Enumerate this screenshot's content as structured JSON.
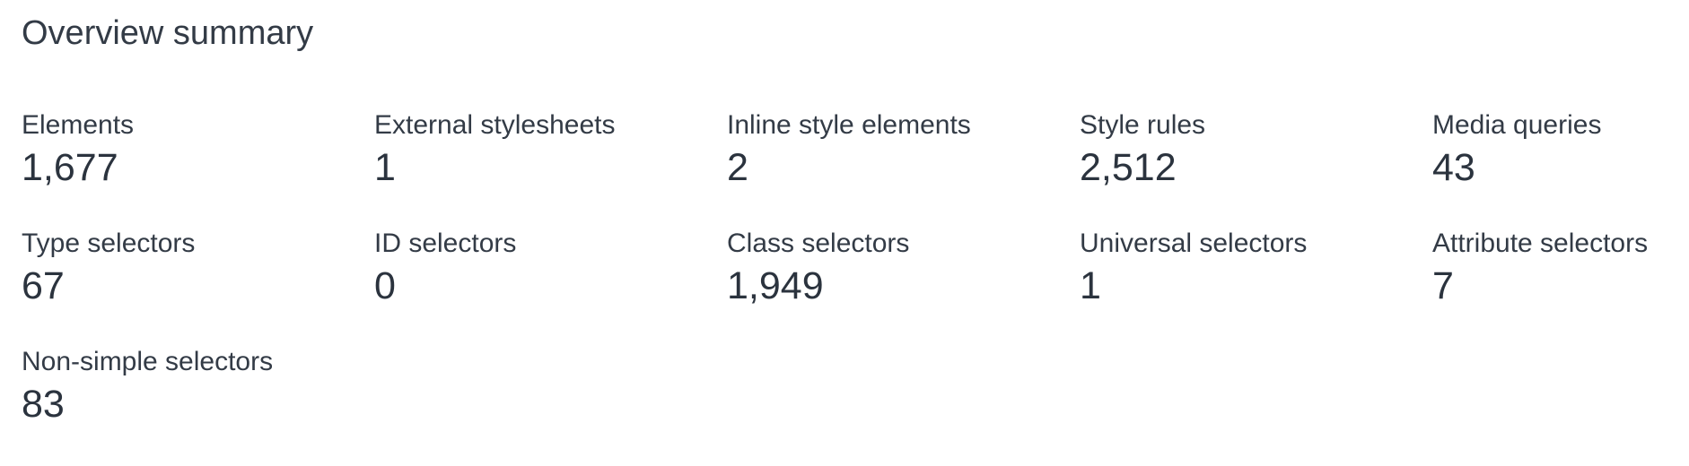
{
  "overview": {
    "title": "Overview summary",
    "metrics": [
      {
        "label": "Elements",
        "value": "1,677"
      },
      {
        "label": "External stylesheets",
        "value": "1"
      },
      {
        "label": "Inline style elements",
        "value": "2"
      },
      {
        "label": "Style rules",
        "value": "2,512"
      },
      {
        "label": "Media queries",
        "value": "43"
      },
      {
        "label": "Type selectors",
        "value": "67"
      },
      {
        "label": "ID selectors",
        "value": "0"
      },
      {
        "label": "Class selectors",
        "value": "1,949"
      },
      {
        "label": "Universal selectors",
        "value": "1"
      },
      {
        "label": "Attribute selectors",
        "value": "7"
      },
      {
        "label": "Non-simple selectors",
        "value": "83"
      }
    ]
  }
}
